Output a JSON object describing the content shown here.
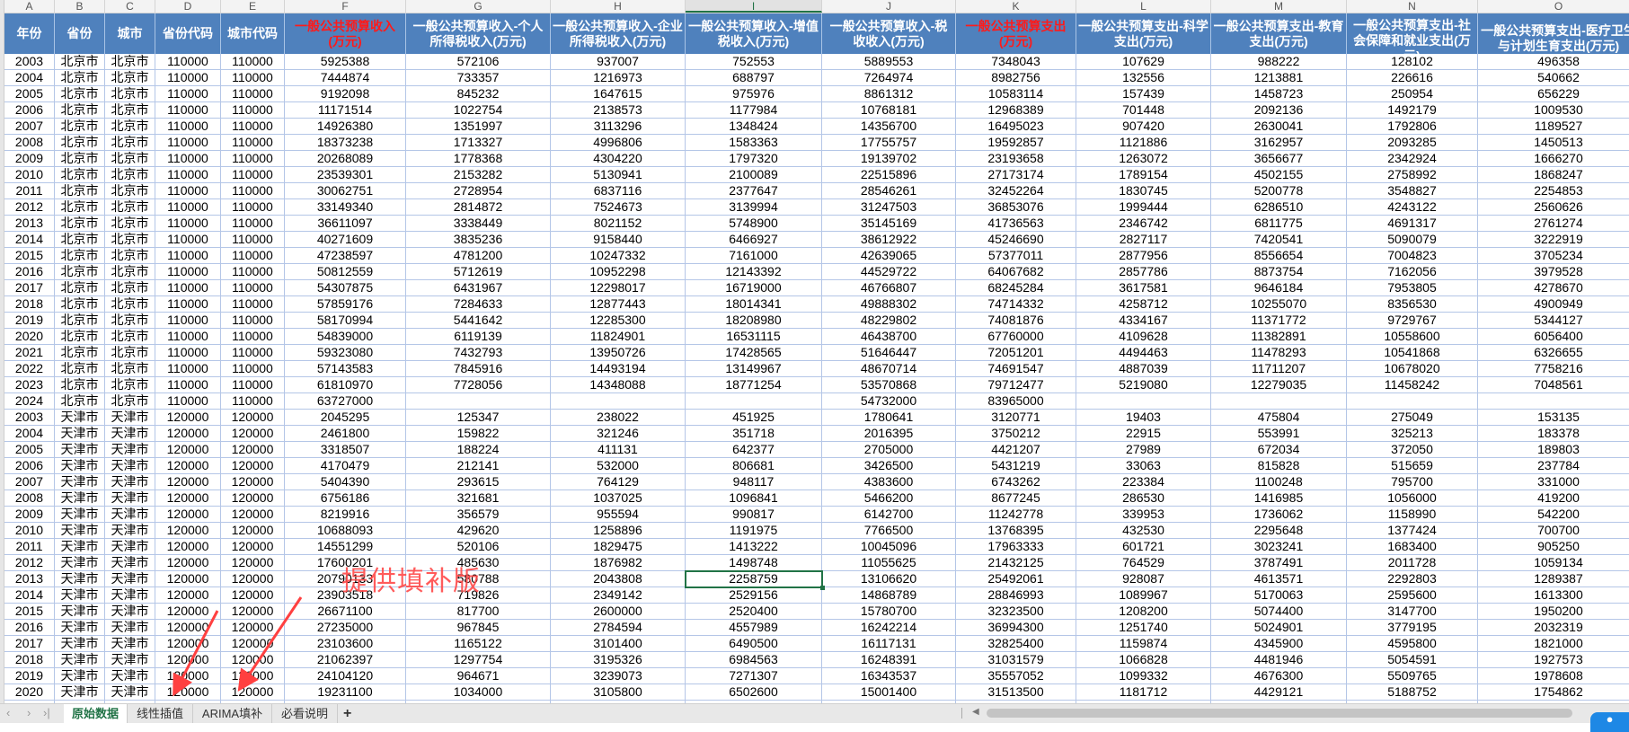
{
  "columns": [
    "A",
    "B",
    "C",
    "D",
    "E",
    "F",
    "G",
    "H",
    "I",
    "J",
    "K",
    "L",
    "M",
    "N",
    "O"
  ],
  "selected_column": "I",
  "headers": [
    {
      "text": "年份",
      "red": false
    },
    {
      "text": "省份",
      "red": false
    },
    {
      "text": "城市",
      "red": false
    },
    {
      "text": "省份代码",
      "red": false
    },
    {
      "text": "城市代码",
      "red": false
    },
    {
      "text": "一般公共预算收入(万元)",
      "red": true
    },
    {
      "text": "一般公共预算收入-个人所得税收入(万元)",
      "red": false
    },
    {
      "text": "一般公共预算收入-企业所得税收入(万元)",
      "red": false
    },
    {
      "text": "一般公共预算收入-增值税收入(万元)",
      "red": false
    },
    {
      "text": "一般公共预算收入-税收收入(万元)",
      "red": false
    },
    {
      "text": "一般公共预算支出(万元)",
      "red": true
    },
    {
      "text": "一般公共预算支出-科学支出(万元)",
      "red": false
    },
    {
      "text": "一般公共预算支出-教育支出(万元)",
      "red": false
    },
    {
      "text": "一般公共预算支出-社会保障和就业支出(万元)",
      "red": false
    },
    {
      "text": "一般公共预算支出-医疗卫生与计划生育支出(万元)",
      "red": false
    }
  ],
  "rows": [
    [
      "2003",
      "北京市",
      "北京市",
      "110000",
      "110000",
      "5925388",
      "572106",
      "937007",
      "752553",
      "5889553",
      "7348043",
      "107629",
      "988222",
      "128102",
      "496358"
    ],
    [
      "2004",
      "北京市",
      "北京市",
      "110000",
      "110000",
      "7444874",
      "733357",
      "1216973",
      "688797",
      "7264974",
      "8982756",
      "132556",
      "1213881",
      "226616",
      "540662"
    ],
    [
      "2005",
      "北京市",
      "北京市",
      "110000",
      "110000",
      "9192098",
      "845232",
      "1647615",
      "975976",
      "8861312",
      "10583114",
      "157439",
      "1458723",
      "250954",
      "656229"
    ],
    [
      "2006",
      "北京市",
      "北京市",
      "110000",
      "110000",
      "11171514",
      "1022754",
      "2138573",
      "1177984",
      "10768181",
      "12968389",
      "701448",
      "2092136",
      "1492179",
      "1009530"
    ],
    [
      "2007",
      "北京市",
      "北京市",
      "110000",
      "110000",
      "14926380",
      "1351997",
      "3113296",
      "1348424",
      "14356700",
      "16495023",
      "907420",
      "2630041",
      "1792806",
      "1189527"
    ],
    [
      "2008",
      "北京市",
      "北京市",
      "110000",
      "110000",
      "18373238",
      "1713327",
      "4996806",
      "1583363",
      "17755757",
      "19592857",
      "1121886",
      "3162957",
      "2093285",
      "1450513"
    ],
    [
      "2009",
      "北京市",
      "北京市",
      "110000",
      "110000",
      "20268089",
      "1778368",
      "4304220",
      "1797320",
      "19139702",
      "23193658",
      "1263072",
      "3656677",
      "2342924",
      "1666270"
    ],
    [
      "2010",
      "北京市",
      "北京市",
      "110000",
      "110000",
      "23539301",
      "2153282",
      "5130941",
      "2100089",
      "22515896",
      "27173174",
      "1789154",
      "4502155",
      "2758992",
      "1868247"
    ],
    [
      "2011",
      "北京市",
      "北京市",
      "110000",
      "110000",
      "30062751",
      "2728954",
      "6837116",
      "2377647",
      "28546261",
      "32452264",
      "1830745",
      "5200778",
      "3548827",
      "2254853"
    ],
    [
      "2012",
      "北京市",
      "北京市",
      "110000",
      "110000",
      "33149340",
      "2814872",
      "7524673",
      "3139994",
      "31247503",
      "36853076",
      "1999444",
      "6286510",
      "4243122",
      "2560626"
    ],
    [
      "2013",
      "北京市",
      "北京市",
      "110000",
      "110000",
      "36611097",
      "3338449",
      "8021152",
      "5748900",
      "35145169",
      "41736563",
      "2346742",
      "6811775",
      "4691317",
      "2761274"
    ],
    [
      "2014",
      "北京市",
      "北京市",
      "110000",
      "110000",
      "40271609",
      "3835236",
      "9158440",
      "6466927",
      "38612922",
      "45246690",
      "2827117",
      "7420541",
      "5090079",
      "3222919"
    ],
    [
      "2015",
      "北京市",
      "北京市",
      "110000",
      "110000",
      "47238597",
      "4781200",
      "10247332",
      "7161000",
      "42639065",
      "57377011",
      "2877956",
      "8556654",
      "7004823",
      "3705234"
    ],
    [
      "2016",
      "北京市",
      "北京市",
      "110000",
      "110000",
      "50812559",
      "5712619",
      "10952298",
      "12143392",
      "44529722",
      "64067682",
      "2857786",
      "8873754",
      "7162056",
      "3979528"
    ],
    [
      "2017",
      "北京市",
      "北京市",
      "110000",
      "110000",
      "54307875",
      "6431967",
      "12298017",
      "16719000",
      "46766807",
      "68245284",
      "3617581",
      "9646184",
      "7953805",
      "4278670"
    ],
    [
      "2018",
      "北京市",
      "北京市",
      "110000",
      "110000",
      "57859176",
      "7284633",
      "12877443",
      "18014341",
      "49888302",
      "74714332",
      "4258712",
      "10255070",
      "8356530",
      "4900949"
    ],
    [
      "2019",
      "北京市",
      "北京市",
      "110000",
      "110000",
      "58170994",
      "5441642",
      "12285300",
      "18208980",
      "48229802",
      "74081876",
      "4334167",
      "11371772",
      "9729767",
      "5344127"
    ],
    [
      "2020",
      "北京市",
      "北京市",
      "110000",
      "110000",
      "54839000",
      "6119139",
      "11824901",
      "16531115",
      "46438700",
      "67760000",
      "4109628",
      "11382891",
      "10558600",
      "6056400"
    ],
    [
      "2021",
      "北京市",
      "北京市",
      "110000",
      "110000",
      "59323080",
      "7432793",
      "13950726",
      "17428565",
      "51646447",
      "72051201",
      "4494463",
      "11478293",
      "10541868",
      "6326655"
    ],
    [
      "2022",
      "北京市",
      "北京市",
      "110000",
      "110000",
      "57143583",
      "7845916",
      "14493194",
      "13149967",
      "48670714",
      "74691547",
      "4887039",
      "11711207",
      "10678020",
      "7758216"
    ],
    [
      "2023",
      "北京市",
      "北京市",
      "110000",
      "110000",
      "61810970",
      "7728056",
      "14348088",
      "18771254",
      "53570868",
      "79712477",
      "5219080",
      "12279035",
      "11458242",
      "7048561"
    ],
    [
      "2024",
      "北京市",
      "北京市",
      "110000",
      "110000",
      "63727000",
      "",
      "",
      "",
      "54732000",
      "83965000",
      "",
      "",
      "",
      ""
    ],
    [
      "2003",
      "天津市",
      "天津市",
      "120000",
      "120000",
      "2045295",
      "125347",
      "238022",
      "451925",
      "1780641",
      "3120771",
      "19403",
      "475804",
      "275049",
      "153135"
    ],
    [
      "2004",
      "天津市",
      "天津市",
      "120000",
      "120000",
      "2461800",
      "159822",
      "321246",
      "351718",
      "2016395",
      "3750212",
      "22915",
      "553991",
      "325213",
      "183378"
    ],
    [
      "2005",
      "天津市",
      "天津市",
      "120000",
      "120000",
      "3318507",
      "188224",
      "411131",
      "642377",
      "2705000",
      "4421207",
      "27989",
      "672034",
      "372050",
      "189803"
    ],
    [
      "2006",
      "天津市",
      "天津市",
      "120000",
      "120000",
      "4170479",
      "212141",
      "532000",
      "806681",
      "3426500",
      "5431219",
      "33063",
      "815828",
      "515659",
      "237784"
    ],
    [
      "2007",
      "天津市",
      "天津市",
      "120000",
      "120000",
      "5404390",
      "293615",
      "764129",
      "948117",
      "4383600",
      "6743262",
      "223384",
      "1100248",
      "795700",
      "331000"
    ],
    [
      "2008",
      "天津市",
      "天津市",
      "120000",
      "120000",
      "6756186",
      "321681",
      "1037025",
      "1096841",
      "5466200",
      "8677245",
      "286530",
      "1416985",
      "1056000",
      "419200"
    ],
    [
      "2009",
      "天津市",
      "天津市",
      "120000",
      "120000",
      "8219916",
      "356579",
      "955594",
      "990817",
      "6142700",
      "11242778",
      "339953",
      "1736062",
      "1158990",
      "542200"
    ],
    [
      "2010",
      "天津市",
      "天津市",
      "120000",
      "120000",
      "10688093",
      "429620",
      "1258896",
      "1191975",
      "7766500",
      "13768395",
      "432530",
      "2295648",
      "1377424",
      "700700"
    ],
    [
      "2011",
      "天津市",
      "天津市",
      "120000",
      "120000",
      "14551299",
      "520106",
      "1829475",
      "1413222",
      "10045096",
      "17963333",
      "601721",
      "3023241",
      "1683400",
      "905250"
    ],
    [
      "2012",
      "天津市",
      "天津市",
      "120000",
      "120000",
      "17600201",
      "485630",
      "1876982",
      "1498748",
      "11055625",
      "21432125",
      "764529",
      "3787491",
      "2011728",
      "1059134"
    ],
    [
      "2013",
      "天津市",
      "天津市",
      "120000",
      "120000",
      "20790133",
      "580788",
      "2043808",
      "2258759",
      "13106620",
      "25492061",
      "928087",
      "4613571",
      "2292803",
      "1289387"
    ],
    [
      "2014",
      "天津市",
      "天津市",
      "120000",
      "120000",
      "23903518",
      "719826",
      "2349142",
      "2529156",
      "14868789",
      "28846993",
      "1089967",
      "5170063",
      "2595600",
      "1613300"
    ],
    [
      "2015",
      "天津市",
      "天津市",
      "120000",
      "120000",
      "26671100",
      "817700",
      "2600000",
      "2520400",
      "15780700",
      "32323500",
      "1208200",
      "5074400",
      "3147700",
      "1950200"
    ],
    [
      "2016",
      "天津市",
      "天津市",
      "120000",
      "120000",
      "27235000",
      "967845",
      "2784594",
      "4557989",
      "16242214",
      "36994300",
      "1251740",
      "5024901",
      "3779195",
      "2032319"
    ],
    [
      "2017",
      "天津市",
      "天津市",
      "120000",
      "120000",
      "23103600",
      "1165122",
      "3101400",
      "6490500",
      "16117131",
      "32825400",
      "1159874",
      "4345900",
      "4595800",
      "1821000"
    ],
    [
      "2018",
      "天津市",
      "天津市",
      "120000",
      "120000",
      "21062397",
      "1297754",
      "3195326",
      "6984563",
      "16248391",
      "31031579",
      "1066828",
      "4481946",
      "5054591",
      "1927573"
    ],
    [
      "2019",
      "天津市",
      "天津市",
      "120000",
      "120000",
      "24104120",
      "964671",
      "3239073",
      "7271307",
      "16343537",
      "35557052",
      "1099332",
      "4676300",
      "5509765",
      "1978608"
    ],
    [
      "2020",
      "天津市",
      "天津市",
      "120000",
      "120000",
      "19231100",
      "1034000",
      "3105800",
      "6502600",
      "15001400",
      "31513500",
      "1181712",
      "4429121",
      "5188752",
      "1754862"
    ],
    [
      "",
      "",
      "",
      "",
      "",
      "",
      "",
      "",
      "",
      "",
      "",
      "",
      "",
      "",
      ""
    ]
  ],
  "annotation": {
    "text": "提供填补版",
    "color": "#ff4a4a"
  },
  "sheet_tabs": [
    {
      "label": "原始数据",
      "active": true
    },
    {
      "label": "线性插值",
      "active": false
    },
    {
      "label": "ARIMA填补",
      "active": false
    },
    {
      "label": "必看说明",
      "active": false
    }
  ],
  "add_sheet_label": "+",
  "nav": {
    "prev": "‹",
    "next": "›",
    "last": "›|"
  },
  "colors": {
    "header_bg": "#4f81bd",
    "header_red": "#ff1a1a",
    "grid": "#b4c6e7",
    "selection": "#217346"
  }
}
